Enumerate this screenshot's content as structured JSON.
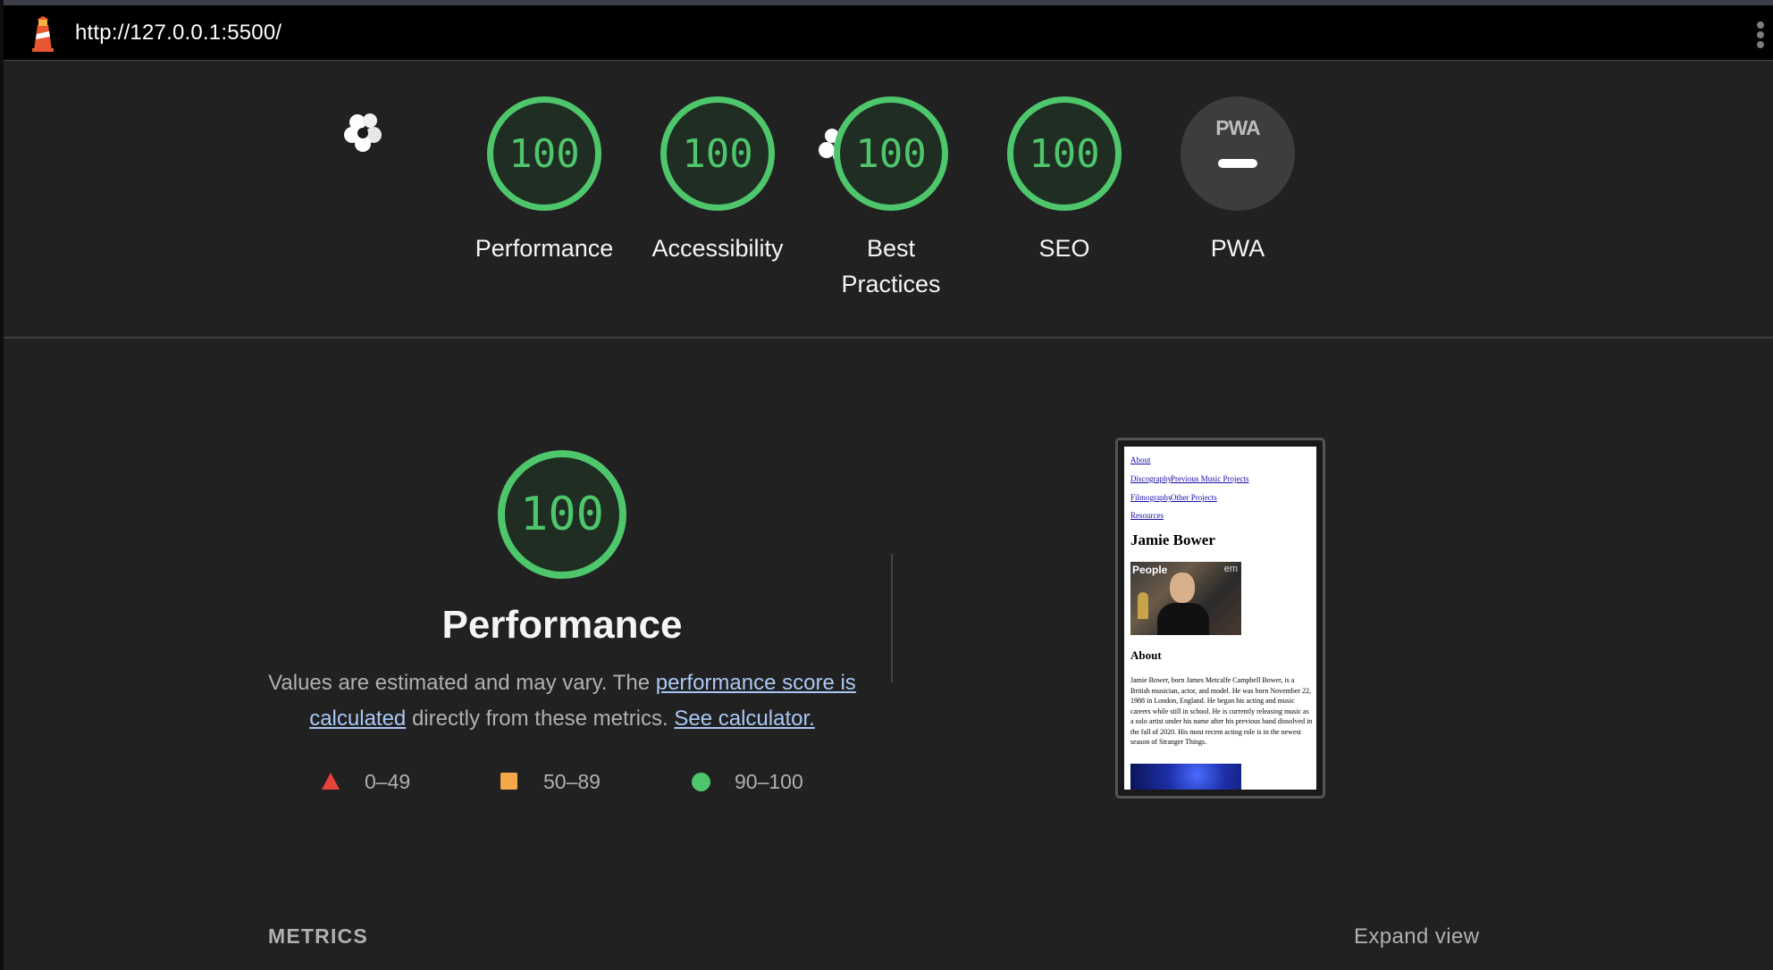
{
  "topbar": {
    "url": "http://127.0.0.1:5500/",
    "logo_icon": "lighthouse-icon",
    "menu_icon": "kebab-menu-icon"
  },
  "scores": {
    "performance": {
      "value": "100",
      "label": "Performance"
    },
    "accessibility": {
      "value": "100",
      "label": "Accessibility"
    },
    "best_practices": {
      "value": "100",
      "label_line1": "Best",
      "label_line2": "Practices"
    },
    "seo": {
      "value": "100",
      "label": "SEO"
    },
    "pwa": {
      "badge": "PWA",
      "label": "PWA"
    }
  },
  "performance_section": {
    "score": "100",
    "title": "Performance",
    "desc_part1": "Values are estimated and may vary. The ",
    "desc_link1": "performance score is calculated",
    "desc_part2": " directly from these metrics. ",
    "desc_link2": "See calculator."
  },
  "legend": {
    "fail": "0–49",
    "average": "50–89",
    "pass": "90–100"
  },
  "thumbnail": {
    "nav_about": "About",
    "nav_discography": "Discography",
    "nav_previous": "Previous Music Projects",
    "nav_filmography": "Filmography",
    "nav_other": "Other Projects",
    "nav_resources": "Resources",
    "heading": "Jamie Bower",
    "photo_brand": "People",
    "photo_brand2": "em",
    "about_heading": "About",
    "about_text": "Jamie Bower, born James Metcalfe Campbell Bower, is a British musician, actor, and model. He was born November 22, 1988 in London, England. He began his acting and music careers while still in school. He is currently releasing music as a solo artist under his name after his previous band dissolved in the fall of 2020. His most recent acting role is in the newest season of Stranger Things."
  },
  "metrics": {
    "title": "METRICS",
    "expand": "Expand view"
  },
  "colors": {
    "pass": "#4ec66b",
    "average": "#f5a84a",
    "fail": "#e8433a",
    "background": "#212121",
    "topbar": "#000000",
    "link": "#a9c8f5"
  }
}
